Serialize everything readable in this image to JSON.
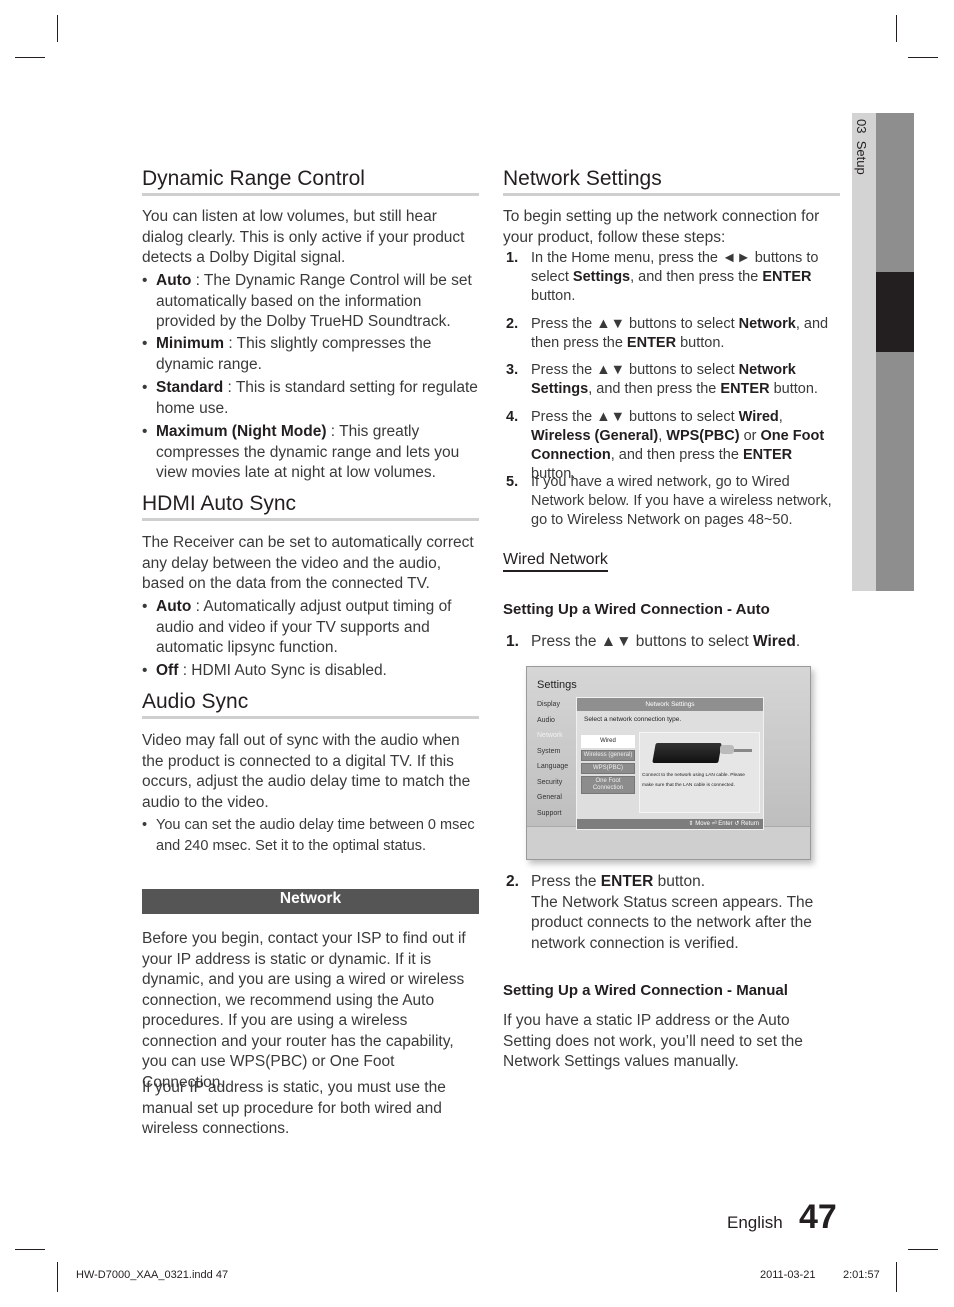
{
  "side_tab": {
    "chapter": "03",
    "label": "Setup"
  },
  "left": {
    "drc": {
      "title": "Dynamic Range Control",
      "intro": "You can listen at low volumes, but still hear dialog clearly. This is only active if your product detects a Dolby Digital signal.",
      "bullets": [
        {
          "term": "Auto",
          "text": " : The Dynamic Range Control will be set automatically based on the information provided by the Dolby TrueHD Soundtrack."
        },
        {
          "term": "Minimum",
          "text": " : This slightly compresses the dynamic range."
        },
        {
          "term": "Standard",
          "text": " : This is standard setting for regulate home use."
        },
        {
          "term": "Maximum (Night Mode)",
          "text": " : This greatly compresses the dynamic range and lets you view movies late at night at low volumes."
        }
      ]
    },
    "hdmi": {
      "title": "HDMI Auto Sync",
      "intro": "The Receiver can be set to automatically correct any delay between the video and the audio, based on the data from the connected TV.",
      "bullets": [
        {
          "term": "Auto",
          "text": " : Automatically adjust output timing of audio and video if your TV supports and automatic lipsync function."
        },
        {
          "term": "Off",
          "text": " : HDMI Auto Sync is disabled."
        }
      ]
    },
    "audio_sync": {
      "title": "Audio Sync",
      "intro": "Video may fall out of sync with the audio when the product is connected to a digital TV. If this occurs, adjust the audio delay time to match the audio to the video.",
      "bullet": "You can set the audio delay time between 0 msec and 240 msec. Set it to the optimal status."
    },
    "network": {
      "bar_label": "Network",
      "para1": "Before you begin, contact your ISP to find out if your IP address is static or dynamic. If it is dynamic, and you are using a wired or wireless connection, we recommend using the Auto procedures. If you are using a wireless connection and your router has the capability, you can use WPS(PBC) or One Foot Connection.",
      "para2": "If your IP address is static, you must use the manual set up procedure for both wired and wireless connections."
    }
  },
  "right": {
    "title": "Network Settings",
    "intro": "To begin setting up the network connection for your product, follow these steps:",
    "steps": [
      {
        "n": "1.",
        "html": "In the Home menu, press the ◄► buttons to select <b>Settings</b>, and then press the <b>ENTER</b> button."
      },
      {
        "n": "2.",
        "html": "Press the ▲▼ buttons to select <b>Network</b>, and then press the <b>ENTER</b> button."
      },
      {
        "n": "3.",
        "html": "Press the ▲▼ buttons to select <b>Network Settings</b>, and then press the <b>ENTER</b> button."
      },
      {
        "n": "4.",
        "html": "Press the ▲▼ buttons to select <b>Wired</b>, <b>Wireless (General)</b>, <b>WPS(PBC)</b> or <b>One Foot Connection</b>, and then press the <b>ENTER</b> button."
      },
      {
        "n": "5.",
        "html": "If you have a wired network, go to Wired Network below. If you have a wireless network, go to Wireless Network on pages 48~50."
      }
    ],
    "wired_network": "Wired Network",
    "auto_heading": "Setting Up a Wired Connection - Auto",
    "auto_step1": {
      "n": "1.",
      "html": "Press the ▲▼ buttons to select <b>Wired</b>."
    },
    "auto_step2": {
      "n": "2.",
      "html": "Press the <b>ENTER</b> button.<br>The Network Status screen appears. The product connects to the network after the network connection is verified."
    },
    "manual_heading": "Setting Up a Wired Connection - Manual",
    "manual_text": "If you have a static IP address or the Auto Setting does not work, you’ll need to set the Network Settings values manually."
  },
  "tv_screen": {
    "title": "Settings",
    "menu": [
      "Display",
      "Audio",
      "Network",
      "System",
      "Language",
      "Security",
      "General",
      "Support"
    ],
    "active_menu": "Network",
    "dialog_title": "Network Settings",
    "prompt": "Select a network connection type.",
    "options": [
      "Wired",
      "Wireless (general)",
      "WPS(PBC)",
      "One Foot Connection"
    ],
    "selected_option": "Wired",
    "description": "Connect to the network using LAN cable. Please make sure that the LAN cable is connected.",
    "footer": "⇕ Move   ⏎ Enter   ↺ Return"
  },
  "page_footer": {
    "language": "English",
    "page_number": "47",
    "file": "HW-D7000_XAA_0321.indd   47",
    "date": "2011-03-21",
    "time": "2:01:57"
  }
}
